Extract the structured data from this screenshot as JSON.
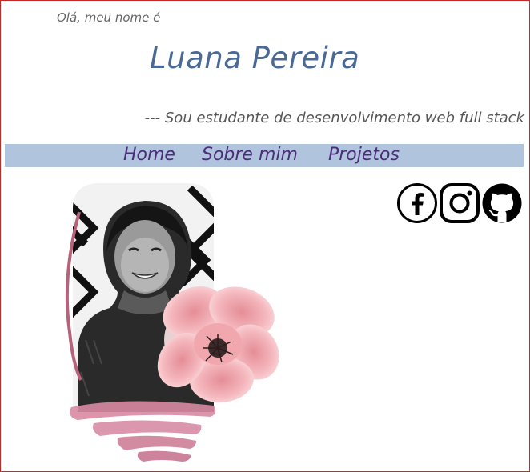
{
  "header": {
    "greeting": "Olá, meu nome é",
    "name": "Luana Pereira",
    "tagline": "--- Sou estudante de desenvolvimento web full stack"
  },
  "nav": {
    "items": [
      {
        "label": "Home"
      },
      {
        "label": "Sobre mim"
      },
      {
        "label": "Projetos"
      }
    ]
  },
  "social": {
    "items": [
      {
        "icon": "facebook-icon"
      },
      {
        "icon": "instagram-icon"
      },
      {
        "icon": "github-icon"
      }
    ]
  },
  "colors": {
    "name": "#4a6a95",
    "nav_background": "#b0c4de",
    "nav_text": "#4b2d7a",
    "border": "#c62828",
    "flower": "#f0a8ae",
    "brush": "#d98aa3"
  }
}
